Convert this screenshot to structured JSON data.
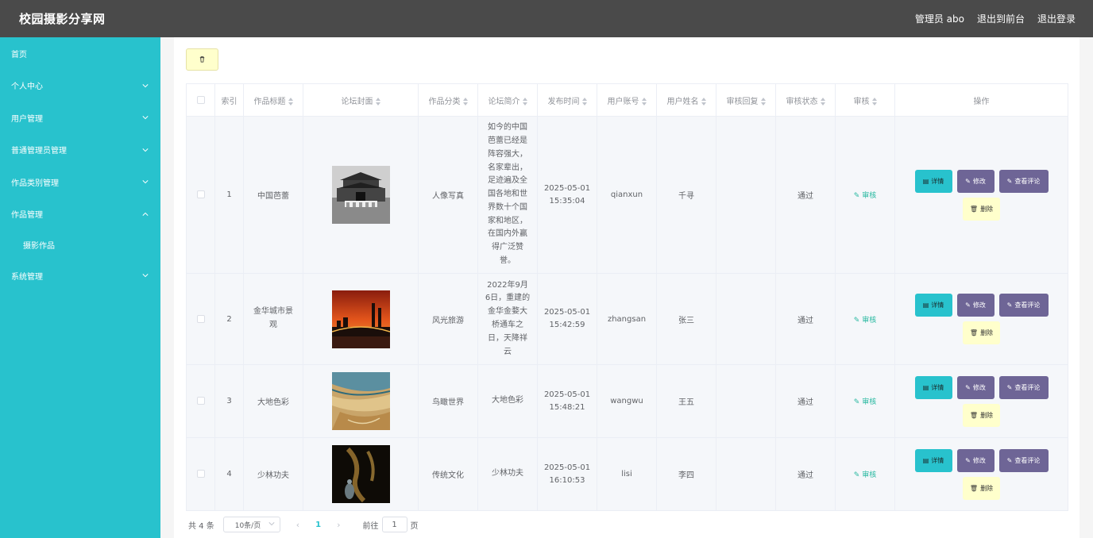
{
  "header": {
    "title": "校园摄影分享网",
    "admin": "管理员 abo",
    "back_front": "退出到前台",
    "logout": "退出登录"
  },
  "sidebar": {
    "items": [
      {
        "label": "首页",
        "expandable": false
      },
      {
        "label": "个人中心",
        "expandable": true,
        "expanded": false
      },
      {
        "label": "用户管理",
        "expandable": true,
        "expanded": false
      },
      {
        "label": "普通管理员管理",
        "expandable": true,
        "expanded": false
      },
      {
        "label": "作品类别管理",
        "expandable": true,
        "expanded": false
      },
      {
        "label": "作品管理",
        "expandable": true,
        "expanded": true
      },
      {
        "label": "摄影作品",
        "sub": true
      },
      {
        "label": "系统管理",
        "expandable": true,
        "expanded": false
      }
    ]
  },
  "table": {
    "columns": [
      "索引",
      "作品标题",
      "论坛封面",
      "作品分类",
      "论坛简介",
      "发布时间",
      "用户账号",
      "用户姓名",
      "审核回复",
      "审核状态",
      "审核",
      "操作"
    ],
    "rows": [
      {
        "index": "1",
        "title": "中国芭蕾",
        "category": "人像写真",
        "intro": "如今的中国芭蕾已经是阵容强大，名家辈出，足迹遍及全国各地和世界数十个国家和地区，在国内外赢得广泛赞誉。",
        "date": "2025-05-01",
        "time": "15:35:04",
        "account": "qianxun",
        "name": "千寻",
        "reply": "",
        "status": "通过"
      },
      {
        "index": "2",
        "title": "金华城市景观",
        "category": "风光旅游",
        "intro": "2022年9月6日，重建的金华金婺大桥通车之日，天降祥云",
        "date": "2025-05-01",
        "time": "15:42:59",
        "account": "zhangsan",
        "name": "张三",
        "reply": "",
        "status": "通过"
      },
      {
        "index": "3",
        "title": "大地色彩",
        "category": "鸟瞰世界",
        "intro": "大地色彩",
        "date": "2025-05-01",
        "time": "15:48:21",
        "account": "wangwu",
        "name": "王五",
        "reply": "",
        "status": "通过"
      },
      {
        "index": "4",
        "title": "少林功夫",
        "category": "传统文化",
        "intro": "少林功夫",
        "date": "2025-05-01",
        "time": "16:10:53",
        "account": "lisi",
        "name": "李四",
        "reply": "",
        "status": "通过"
      }
    ],
    "audit_label": "审核",
    "actions": {
      "detail": "详情",
      "edit": "修改",
      "comments": "查看评论",
      "delete": "删除"
    }
  },
  "pagination": {
    "total": "共 4 条",
    "page_size": "10条/页",
    "current_page": "1",
    "goto_label": "前往",
    "goto_value": "1",
    "page_unit": "页"
  },
  "colors": {
    "topbar": "#4a4a4a",
    "sidebar": "#28c2cd",
    "detail_button": "#28c2cd",
    "edit_button": "#6e6596",
    "delete_button": "#ffffcc",
    "audit_link": "#28b8a0"
  }
}
